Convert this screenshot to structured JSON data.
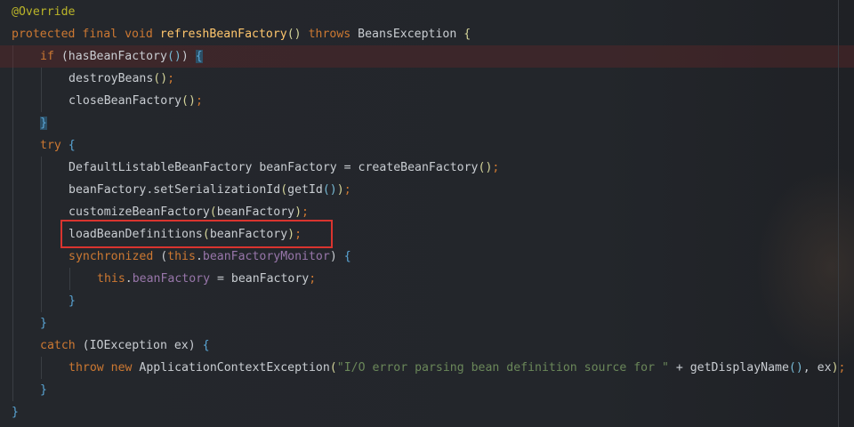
{
  "colors": {
    "keyword": "#cc7832",
    "annotation": "#bbb529",
    "method": "#ffc66d",
    "field": "#9876aa",
    "string": "#6a8759",
    "plain": "#c9cdd2",
    "paren1": "#d4d49a",
    "paren2": "#77b9d4",
    "brace": "#5aa6d6",
    "highlight_box": "#d9342f"
  },
  "code_lines": [
    {
      "indent": 0,
      "highlight": false,
      "tokens": [
        {
          "t": "@Override",
          "c": "annotation"
        }
      ]
    },
    {
      "indent": 0,
      "highlight": false,
      "tokens": [
        {
          "t": "protected",
          "c": "keyword"
        },
        {
          "t": " "
        },
        {
          "t": "final",
          "c": "keyword"
        },
        {
          "t": " "
        },
        {
          "t": "void",
          "c": "keyword"
        },
        {
          "t": " "
        },
        {
          "t": "refreshBeanFactory",
          "c": "method"
        },
        {
          "t": "()",
          "c": "paren1"
        },
        {
          "t": " "
        },
        {
          "t": "throws",
          "c": "keyword"
        },
        {
          "t": " BeansException "
        },
        {
          "t": "{",
          "c": "paren1"
        }
      ]
    },
    {
      "indent": 1,
      "highlight": true,
      "tokens": [
        {
          "t": "if",
          "c": "keyword"
        },
        {
          "t": " ("
        },
        {
          "t": "hasBeanFactory"
        },
        {
          "t": "()",
          "c": "paren2"
        },
        {
          "t": ") "
        },
        {
          "t": "{",
          "c": "brace",
          "match": true
        }
      ]
    },
    {
      "indent": 2,
      "highlight": false,
      "tokens": [
        {
          "t": "destroyBeans"
        },
        {
          "t": "()",
          "c": "paren1"
        },
        {
          "t": ";",
          "c": "keyword"
        }
      ]
    },
    {
      "indent": 2,
      "highlight": false,
      "tokens": [
        {
          "t": "closeBeanFactory"
        },
        {
          "t": "()",
          "c": "paren1"
        },
        {
          "t": ";",
          "c": "keyword"
        }
      ]
    },
    {
      "indent": 1,
      "highlight": false,
      "tokens": [
        {
          "t": "}",
          "c": "brace",
          "match": true
        }
      ]
    },
    {
      "indent": 1,
      "highlight": false,
      "tokens": [
        {
          "t": "try",
          "c": "keyword"
        },
        {
          "t": " "
        },
        {
          "t": "{",
          "c": "brace"
        }
      ]
    },
    {
      "indent": 2,
      "highlight": false,
      "tokens": [
        {
          "t": "DefaultListableBeanFactory beanFactory = createBeanFactory"
        },
        {
          "t": "()",
          "c": "paren1"
        },
        {
          "t": ";",
          "c": "keyword"
        }
      ]
    },
    {
      "indent": 2,
      "highlight": false,
      "tokens": [
        {
          "t": "beanFactory.setSerializationId"
        },
        {
          "t": "(",
          "c": "paren1"
        },
        {
          "t": "getId"
        },
        {
          "t": "()",
          "c": "paren2"
        },
        {
          "t": ")",
          "c": "paren1"
        },
        {
          "t": ";",
          "c": "keyword"
        }
      ]
    },
    {
      "indent": 2,
      "highlight": false,
      "tokens": [
        {
          "t": "customizeBeanFactory"
        },
        {
          "t": "(",
          "c": "paren1"
        },
        {
          "t": "beanFactory"
        },
        {
          "t": ")",
          "c": "paren1"
        },
        {
          "t": ";",
          "c": "keyword"
        }
      ]
    },
    {
      "indent": 2,
      "highlight": false,
      "tokens": [
        {
          "t": "loadBeanDefinitions"
        },
        {
          "t": "(",
          "c": "paren1"
        },
        {
          "t": "beanFactory"
        },
        {
          "t": ")",
          "c": "paren1"
        },
        {
          "t": ";",
          "c": "keyword"
        }
      ]
    },
    {
      "indent": 2,
      "highlight": false,
      "tokens": [
        {
          "t": "synchronized",
          "c": "keyword"
        },
        {
          "t": " ("
        },
        {
          "t": "this",
          "c": "keyword"
        },
        {
          "t": "."
        },
        {
          "t": "beanFactoryMonitor",
          "c": "field"
        },
        {
          "t": ") "
        },
        {
          "t": "{",
          "c": "brace"
        }
      ]
    },
    {
      "indent": 3,
      "highlight": false,
      "tokens": [
        {
          "t": "this",
          "c": "keyword"
        },
        {
          "t": "."
        },
        {
          "t": "beanFactory",
          "c": "field"
        },
        {
          "t": " = beanFactory"
        },
        {
          "t": ";",
          "c": "keyword"
        }
      ]
    },
    {
      "indent": 2,
      "highlight": false,
      "tokens": [
        {
          "t": "}",
          "c": "brace"
        }
      ]
    },
    {
      "indent": 1,
      "highlight": false,
      "tokens": [
        {
          "t": "}",
          "c": "brace"
        }
      ]
    },
    {
      "indent": 1,
      "highlight": false,
      "tokens": [
        {
          "t": "catch",
          "c": "keyword"
        },
        {
          "t": " (IOException ex) "
        },
        {
          "t": "{",
          "c": "brace"
        }
      ]
    },
    {
      "indent": 2,
      "highlight": false,
      "tokens": [
        {
          "t": "throw",
          "c": "keyword"
        },
        {
          "t": " "
        },
        {
          "t": "new",
          "c": "keyword"
        },
        {
          "t": " ApplicationContextException"
        },
        {
          "t": "(",
          "c": "paren1"
        },
        {
          "t": "\"I/O error parsing bean definition source for \"",
          "c": "string"
        },
        {
          "t": " + getDisplayName"
        },
        {
          "t": "()",
          "c": "paren2"
        },
        {
          "t": ", ex"
        },
        {
          "t": ")",
          "c": "paren1"
        },
        {
          "t": ";",
          "c": "keyword"
        }
      ]
    },
    {
      "indent": 1,
      "highlight": false,
      "tokens": [
        {
          "t": "}",
          "c": "brace"
        }
      ]
    },
    {
      "indent": 0,
      "highlight": false,
      "tokens": [
        {
          "t": "}",
          "c": "brace"
        }
      ]
    }
  ]
}
